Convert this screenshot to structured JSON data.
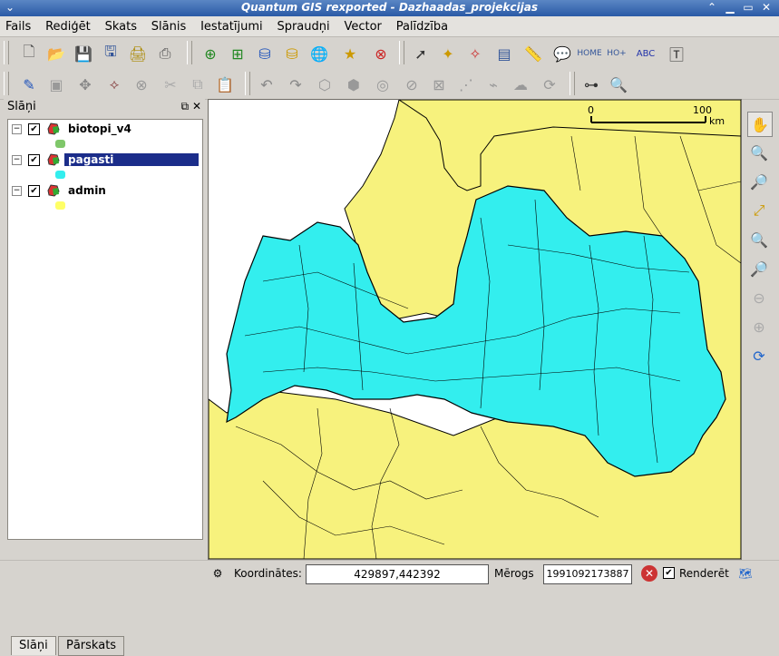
{
  "window": {
    "title": "Quantum GIS rexported - Dazhaadas_projekcijas"
  },
  "menubar": {
    "items": [
      "Fails",
      "Rediģēt",
      "Skats",
      "Slānis",
      "Iestatījumi",
      "Spraudņi",
      "Vector",
      "Palīdzība"
    ]
  },
  "layers_panel": {
    "title": "Slāņi",
    "layers": [
      {
        "name": "biotopi_v4",
        "checked": true,
        "swatch_color": "#7fc76a"
      },
      {
        "name": "pagasti",
        "checked": true,
        "swatch_color": "#33eeee",
        "selected": true
      },
      {
        "name": "admin",
        "checked": true,
        "swatch_color": "#ffff66"
      }
    ],
    "tabs": [
      "Slāņi",
      "Pārskats"
    ]
  },
  "map": {
    "scalebar": {
      "start": "0",
      "end": "100",
      "unit": "km"
    },
    "colors": {
      "land": "#f7f27d",
      "pagasti": "#33eeee",
      "sea": "#ffffff"
    }
  },
  "statusbar": {
    "coord_label": "Koordinātes:",
    "coord_value": "429897,442392",
    "scale_label": "Mērogs",
    "scale_value": "1991092173887",
    "render_label": "Renderēt",
    "render_checked": true
  },
  "icons": {
    "toolbar1": [
      "new-project-icon",
      "open-project-icon",
      "save-project-icon",
      "save-as-icon",
      "print-composer-icon",
      "print-icon",
      "add-vector-icon",
      "add-raster-icon",
      "add-postgis-icon",
      "add-wms-icon",
      "add-wfs-icon",
      "remove-layer-icon",
      "identify-icon",
      "select-icon",
      "deselect-icon",
      "attribute-table-icon",
      "measure-icon",
      "map-tips-icon",
      "home-icon",
      "home-plus-icon",
      "label-icon",
      "text-annotation-icon"
    ],
    "toolbar2": [
      "pencil-icon",
      "save-edits-icon",
      "move-icon",
      "node-tool-icon",
      "delete-icon",
      "cut-icon",
      "copy-icon",
      "paste-icon",
      "undo-icon",
      "redo-icon",
      "add-ring-icon",
      "add-island-icon",
      "delete-ring-icon",
      "delete-part-icon",
      "split-icon",
      "merge-icon",
      "simplify-icon",
      "reshape-icon",
      "rotate-icon",
      "capture-gps-icon",
      "zoom-select-icon"
    ],
    "vtools": [
      "pan-hand-icon",
      "zoom-in-icon",
      "zoom-out-icon",
      "zoom-full-icon",
      "zoom-layer-icon",
      "zoom-select-icon",
      "zoom-last-icon",
      "zoom-next-icon",
      "refresh-icon"
    ]
  }
}
